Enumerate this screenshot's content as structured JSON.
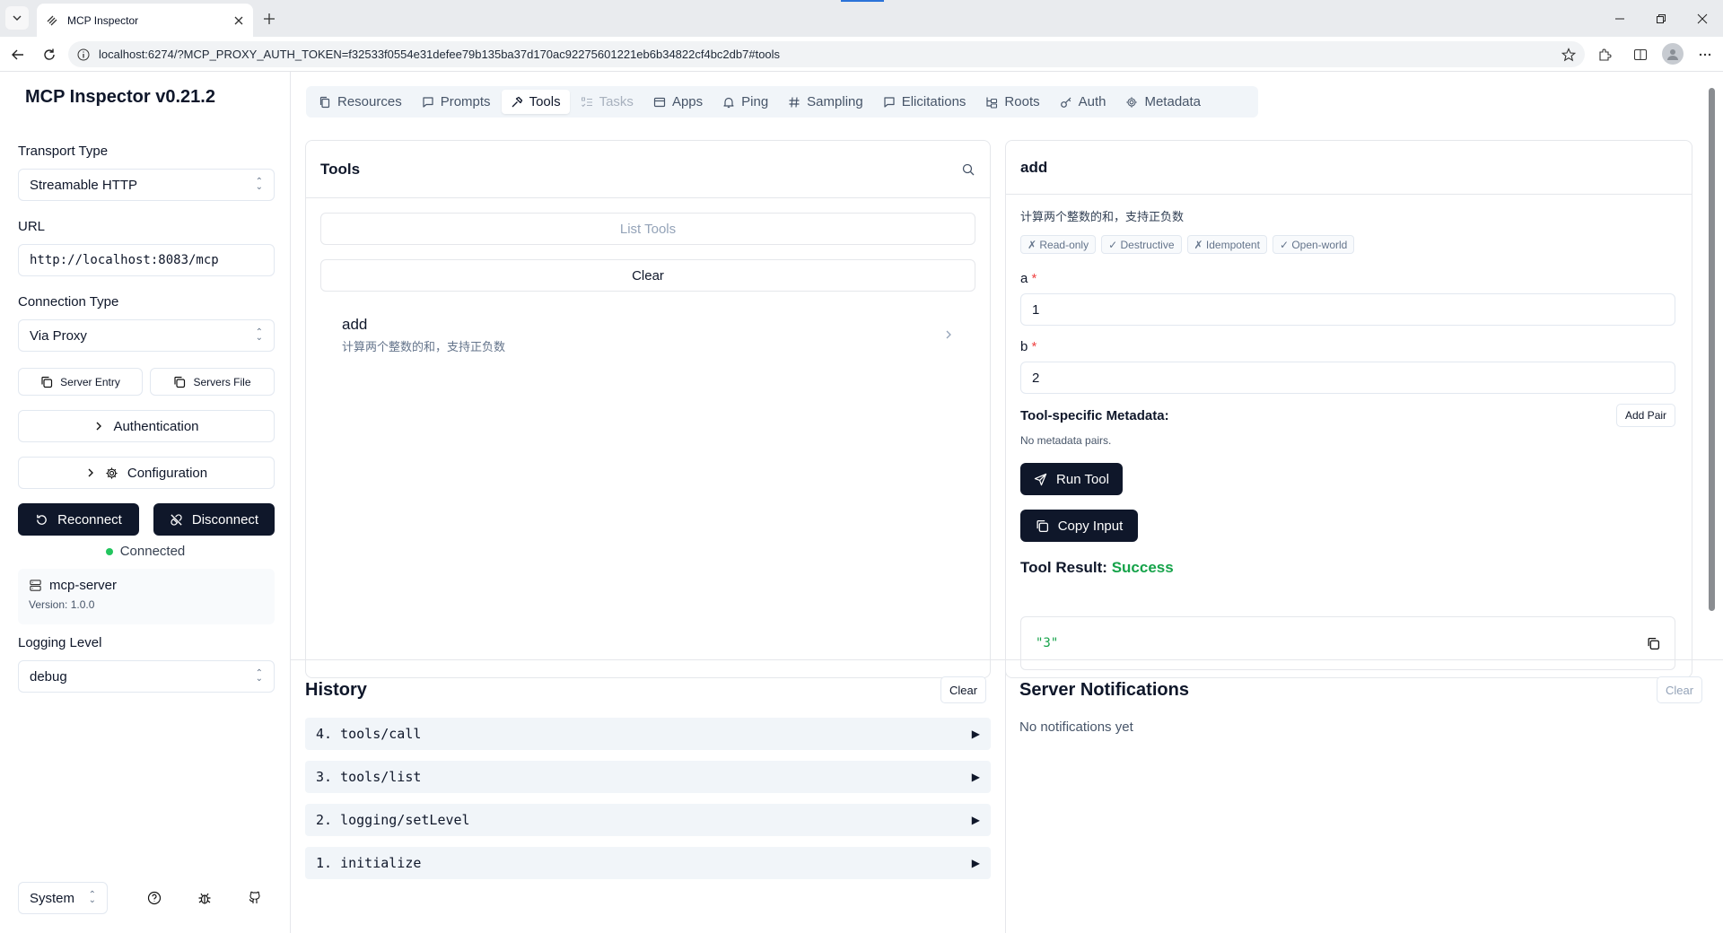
{
  "browser": {
    "tab_title": "MCP Inspector",
    "url": "localhost:6274/?MCP_PROXY_AUTH_TOKEN=f32533f0554e31defee79b135ba37d170ac92275601221eb6b34822cf4bc2db7#tools"
  },
  "sidebar": {
    "title": "MCP Inspector v0.21.2",
    "transport_label": "Transport Type",
    "transport_value": "Streamable HTTP",
    "url_label": "URL",
    "url_value": "http://localhost:8083/mcp",
    "connection_label": "Connection Type",
    "connection_value": "Via Proxy",
    "server_entry": "Server Entry",
    "servers_file": "Servers File",
    "authentication": "Authentication",
    "configuration": "Configuration",
    "reconnect": "Reconnect",
    "disconnect": "Disconnect",
    "status": "Connected",
    "server_name": "mcp-server",
    "server_version": "Version: 1.0.0",
    "logging_label": "Logging Level",
    "logging_value": "debug",
    "theme_value": "System"
  },
  "tabs": [
    {
      "label": "Resources",
      "icon": "file-icon"
    },
    {
      "label": "Prompts",
      "icon": "message-square-icon"
    },
    {
      "label": "Tools",
      "icon": "hammer-icon",
      "active": true
    },
    {
      "label": "Tasks",
      "icon": "list-todo-icon",
      "disabled": true
    },
    {
      "label": "Apps",
      "icon": "app-window-icon"
    },
    {
      "label": "Ping",
      "icon": "bell-icon"
    },
    {
      "label": "Sampling",
      "icon": "hash-icon"
    },
    {
      "label": "Elicitations",
      "icon": "message-square-icon"
    },
    {
      "label": "Roots",
      "icon": "folder-tree-icon"
    },
    {
      "label": "Auth",
      "icon": "key-icon"
    },
    {
      "label": "Metadata",
      "icon": "gear-icon"
    }
  ],
  "tools_panel": {
    "title": "Tools",
    "list_button": "List Tools",
    "clear_button": "Clear",
    "items": [
      {
        "name": "add",
        "description": "计算两个整数的和，支持正负数"
      }
    ]
  },
  "tool_detail": {
    "name": "add",
    "description": "计算两个整数的和，支持正负数",
    "badges": [
      "✗ Read-only",
      "✓ Destructive",
      "✗ Idempotent",
      "✓ Open-world"
    ],
    "param_a_label": "a",
    "param_a_value": "1",
    "param_b_label": "b",
    "param_b_value": "2",
    "required_mark": "*",
    "metadata_title": "Tool-specific Metadata:",
    "add_pair": "Add Pair",
    "no_metadata": "No metadata pairs.",
    "run_tool": "Run Tool",
    "copy_input": "Copy Input",
    "result_label": "Tool Result:",
    "result_status": "Success",
    "result_value": "\"3\""
  },
  "history": {
    "title": "History",
    "clear": "Clear",
    "items": [
      "4. tools/call",
      "3. tools/list",
      "2. logging/setLevel",
      "1. initialize"
    ]
  },
  "notifications": {
    "title": "Server Notifications",
    "clear": "Clear",
    "empty": "No notifications yet"
  },
  "colors": {
    "primary_dark": "#0f172a",
    "success": "#16a34a",
    "connected_dot": "#22c55e",
    "required": "#ef4444"
  }
}
